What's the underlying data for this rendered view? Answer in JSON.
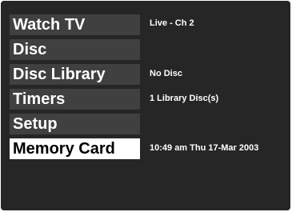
{
  "menu": {
    "items": [
      {
        "label": "Watch TV",
        "selected": false
      },
      {
        "label": "Disc",
        "selected": false
      },
      {
        "label": "Disc Library",
        "selected": false
      },
      {
        "label": "Timers",
        "selected": false
      },
      {
        "label": "Setup",
        "selected": false
      },
      {
        "label": "Memory Card",
        "selected": true
      }
    ]
  },
  "info": {
    "tv_status": "Live - Ch 2",
    "disc_status": "No Disc",
    "library_status": "1 Library Disc(s)",
    "datetime": "10:49 am Thu 17-Mar 2003"
  },
  "colors": {
    "background": "#262626",
    "item_background": "#404040",
    "selected_background": "#ffffff",
    "text": "#ffffff",
    "selected_text": "#000000"
  }
}
